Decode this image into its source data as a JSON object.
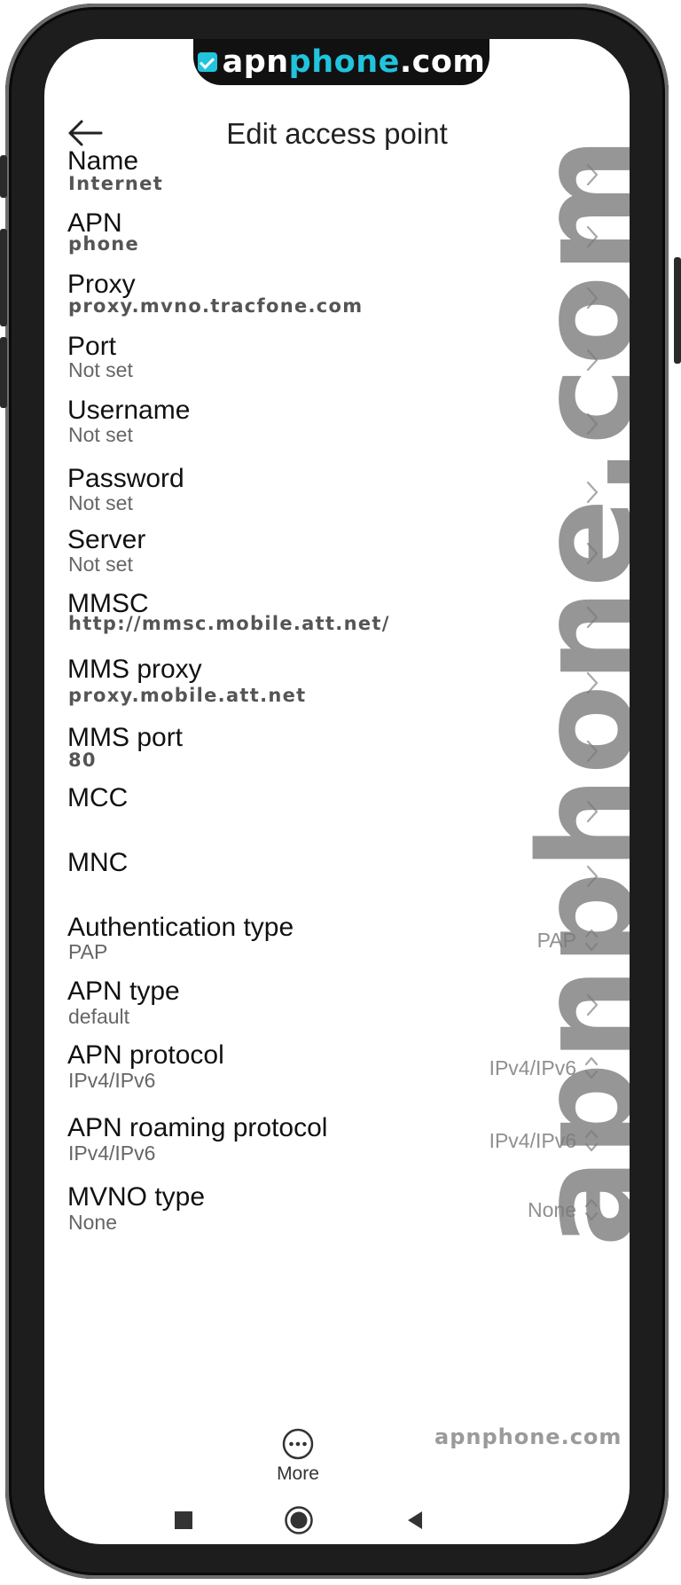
{
  "watermark": {
    "logo_prefix": "apn",
    "logo_highlight": "phone",
    "logo_suffix": ".com",
    "vertical": "apnphone.com",
    "bottom": "apnphone.com"
  },
  "header": {
    "title": "Edit access point",
    "back_icon": "arrow-left-icon"
  },
  "fields": [
    {
      "label": "Name",
      "value": "Internet",
      "control": "chevron"
    },
    {
      "label": "APN",
      "value": "phone",
      "control": "chevron"
    },
    {
      "label": "Proxy",
      "value": "proxy.mvno.tracfone.com",
      "control": "chevron"
    },
    {
      "label": "Port",
      "value": "Not set",
      "control": "chevron"
    },
    {
      "label": "Username",
      "value": "Not set",
      "control": "chevron"
    },
    {
      "label": "Password",
      "value": "Not set",
      "control": "chevron"
    },
    {
      "label": "Server",
      "value": "Not set",
      "control": "chevron"
    },
    {
      "label": "MMSC",
      "value": "http://mmsc.mobile.att.net/",
      "control": "chevron"
    },
    {
      "label": "MMS proxy",
      "value": "proxy.mobile.att.net",
      "control": "chevron"
    },
    {
      "label": "MMS port",
      "value": "80",
      "control": "chevron"
    },
    {
      "label": "MCC",
      "value": "",
      "control": "chevron"
    },
    {
      "label": "MNC",
      "value": "",
      "control": "chevron"
    },
    {
      "label": "Authentication type",
      "value": "PAP",
      "control": "picker",
      "selected": "PAP"
    },
    {
      "label": "APN type",
      "value": "default",
      "control": "chevron"
    },
    {
      "label": "APN protocol",
      "value": "IPv4/IPv6",
      "control": "picker",
      "selected": "IPv4/IPv6"
    },
    {
      "label": "APN roaming protocol",
      "value": "IPv4/IPv6",
      "control": "picker",
      "selected": "IPv4/IPv6"
    },
    {
      "label": "MVNO type",
      "value": "None",
      "control": "picker",
      "selected": "None"
    }
  ],
  "bottom_bar": {
    "more_label": "More",
    "more_icon": "more-dots-icon"
  },
  "nav": {
    "recents_icon": "square-recents-icon",
    "home_icon": "circle-home-icon",
    "back_icon": "triangle-back-icon"
  },
  "colors": {
    "frame": "#1d1d1d",
    "accent": "#20c4dc",
    "text_primary": "#111111",
    "text_secondary": "#666666"
  }
}
